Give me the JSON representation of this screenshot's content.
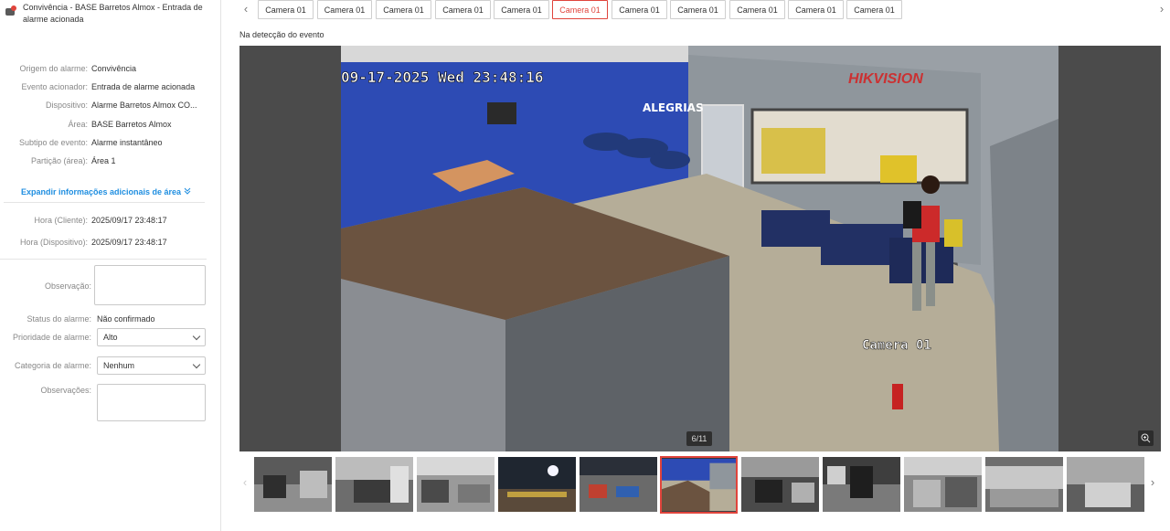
{
  "title": "Convivência - BASE Barretos Almox - Entrada de alarme acionada",
  "details": [
    {
      "label": "Origem do alarme:",
      "value": "Convivência"
    },
    {
      "label": "Evento acionador:",
      "value": "Entrada de alarme acionada"
    },
    {
      "label": "Dispositivo:",
      "value": "Alarme Barretos Almox CO..."
    },
    {
      "label": "Área:",
      "value": "BASE Barretos Almox"
    },
    {
      "label": "Subtipo de evento:",
      "value": "Alarme instantâneo"
    },
    {
      "label": "Partição (área):",
      "value": "Área 1"
    }
  ],
  "expand_label": "Expandir informações adicionais de área",
  "times": [
    {
      "label": "Hora (Cliente):",
      "value": "2025/09/17 23:48:17"
    },
    {
      "label": "Hora (Dispositivo):",
      "value": "2025/09/17 23:48:17"
    }
  ],
  "form": {
    "observation_label": "Observação:",
    "status_label": "Status do alarme:",
    "status_value": "Não confirmado",
    "priority_label": "Prioridade de alarme:",
    "priority_value": "Alto",
    "category_label": "Categoria de alarme:",
    "category_value": "Nenhum",
    "notes_label": "Observações:"
  },
  "tabs": [
    "Camera 01",
    "Camera 01",
    "Camera 01",
    "Camera 01",
    "Camera 01",
    "Camera 01",
    "Camera 01",
    "Camera 01",
    "Camera 01",
    "Camera 01",
    "Camera 01"
  ],
  "active_tab": 5,
  "section_label": "Na detecção do evento",
  "video": {
    "timestamp_overlay": "09-17-2025 Wed 23:48:16",
    "brand_overlay": "HIKVISION",
    "camera_overlay": "Camera 01",
    "counter": "6/11",
    "wall_text": "ALEGRIAS"
  },
  "thumbnails_count": 11,
  "active_thumbnail": 5,
  "colors": {
    "accent": "#e0443c",
    "link": "#1f8ee0"
  }
}
